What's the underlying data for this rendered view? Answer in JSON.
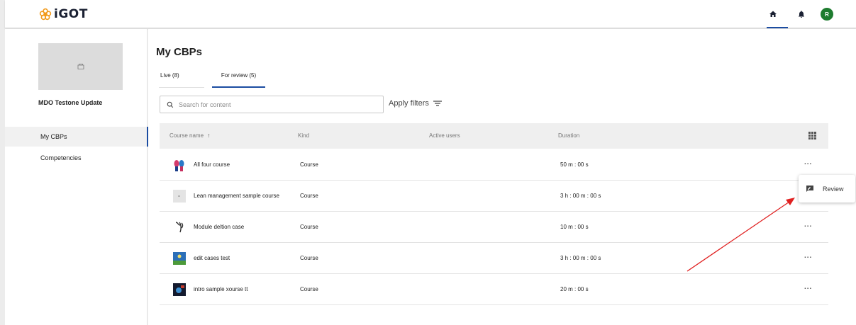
{
  "header": {
    "logo_text": "iGOT",
    "icons": [
      "home-icon",
      "bell-icon"
    ],
    "avatar_initial": "R",
    "colors": {
      "brand": "#1b4ca1",
      "avatar": "#1e7c2f",
      "logo_flower": "#f29b1d"
    }
  },
  "sidebar": {
    "org_name": "MDO Testone Update",
    "items": [
      {
        "label": "My CBPs",
        "active": true
      },
      {
        "label": "Competencies",
        "active": false
      }
    ]
  },
  "main": {
    "title": "My CBPs",
    "tabs": [
      {
        "label": "Live (8)",
        "active": false
      },
      {
        "label": "For review (5)",
        "active": true
      }
    ],
    "search": {
      "placeholder": "Search for content",
      "value": ""
    },
    "apply_filters": "Apply filters",
    "table": {
      "columns": [
        "Course name",
        "Kind",
        "Active users",
        "Duration"
      ],
      "sort_indicator": "↑",
      "rows": [
        {
          "name": "All four course",
          "kind": "Course",
          "active_users": "",
          "duration": "50 m : 00 s",
          "thumb": "figures"
        },
        {
          "name": "Lean management sample course",
          "kind": "Course",
          "active_users": "",
          "duration": "3 h : 00 m : 00 s",
          "thumb": "blank"
        },
        {
          "name": "Module deltion case",
          "kind": "Course",
          "active_users": "",
          "duration": "10 m : 00 s",
          "thumb": "sketch"
        },
        {
          "name": "edit cases test",
          "kind": "Course",
          "active_users": "",
          "duration": "3 h : 00 m : 00 s",
          "thumb": "landscape"
        },
        {
          "name": "intro sample xourse tt",
          "kind": "Course",
          "active_users": "",
          "duration": "20 m : 00 s",
          "thumb": "dark"
        }
      ],
      "more_label": "..."
    }
  },
  "popup_menu": {
    "items": [
      {
        "label": "Review",
        "icon": "rate-review-icon"
      }
    ]
  }
}
